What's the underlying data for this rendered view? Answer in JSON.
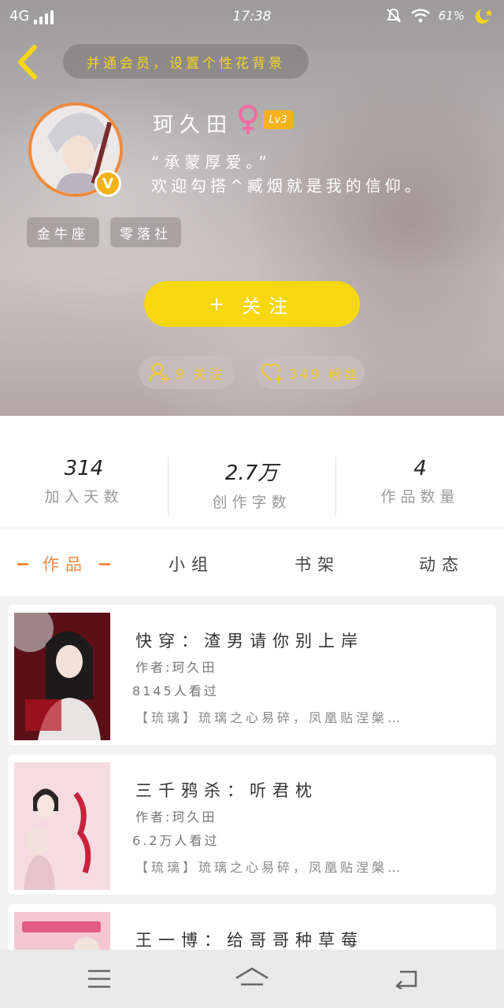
{
  "status_bar": {
    "network": "4G",
    "time": "17:38",
    "battery": "61%"
  },
  "header": {
    "banner_label": "并通会员，设置个性花背景",
    "username": "珂久田",
    "level": "Lv3",
    "quote": "“承蒙厚爱。”",
    "bio": "欢迎勾搭^臧烟就是我的信仰。",
    "tags": [
      "金牛座",
      "零落社"
    ],
    "follow_label": "关注",
    "following_label": "9 关注",
    "fans_label": "349 粉丝"
  },
  "stats": [
    {
      "value": "314",
      "label": "加入天数"
    },
    {
      "value": "2.7万",
      "label": "创作字数"
    },
    {
      "value": "4",
      "label": "作品数量"
    }
  ],
  "tabs": [
    "作品",
    "小组",
    "书架",
    "动态"
  ],
  "works": [
    {
      "title": "快穿：渣男请你别上岸",
      "author": "作者:珂久田",
      "views": "8145人看过",
      "desc": "【琉璃】琉璃之心易碎，凤凰贴涅槃…"
    },
    {
      "title": "三千鸦杀：听君枕",
      "author": "作者:珂久田",
      "views": "6.2万人看过",
      "desc": "【琉璃】琉璃之心易碎，凤凰贴涅槃…"
    },
    {
      "title": "王一博：给哥哥种草莓",
      "author": "",
      "views": "",
      "desc": ""
    }
  ],
  "colors": {
    "accent_yellow": "#f7d70f",
    "accent_orange": "#ef8a43",
    "gender_pink": "#f06ca0"
  },
  "icons": [
    "back-arrow-icon",
    "female-icon",
    "verified-badge-icon",
    "add-user-icon",
    "heart-plus-icon",
    "menu-icon",
    "home-icon",
    "back-icon"
  ]
}
